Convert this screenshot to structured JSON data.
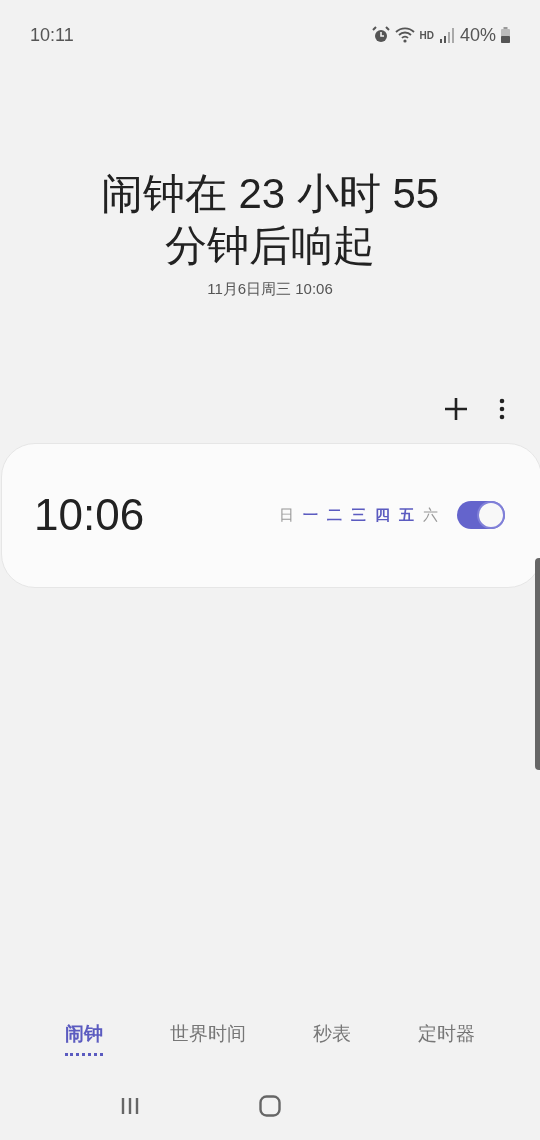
{
  "status_bar": {
    "time": "10:11",
    "network": "HD",
    "battery": "40%"
  },
  "header": {
    "title": "闹钟在 23 小时 55 分钟后响起",
    "subtitle": "11月6日周三 10:06"
  },
  "alarms": [
    {
      "time": "10:06",
      "on": true,
      "days": [
        {
          "label": "日",
          "active": false
        },
        {
          "label": "一",
          "active": true
        },
        {
          "label": "二",
          "active": true
        },
        {
          "label": "三",
          "active": true
        },
        {
          "label": "四",
          "active": true
        },
        {
          "label": "五",
          "active": true
        },
        {
          "label": "六",
          "active": false
        }
      ]
    }
  ],
  "tabs": [
    {
      "label": "闹钟",
      "selected": true
    },
    {
      "label": "世界时间",
      "selected": false
    },
    {
      "label": "秒表",
      "selected": false
    },
    {
      "label": "定时器",
      "selected": false
    }
  ]
}
